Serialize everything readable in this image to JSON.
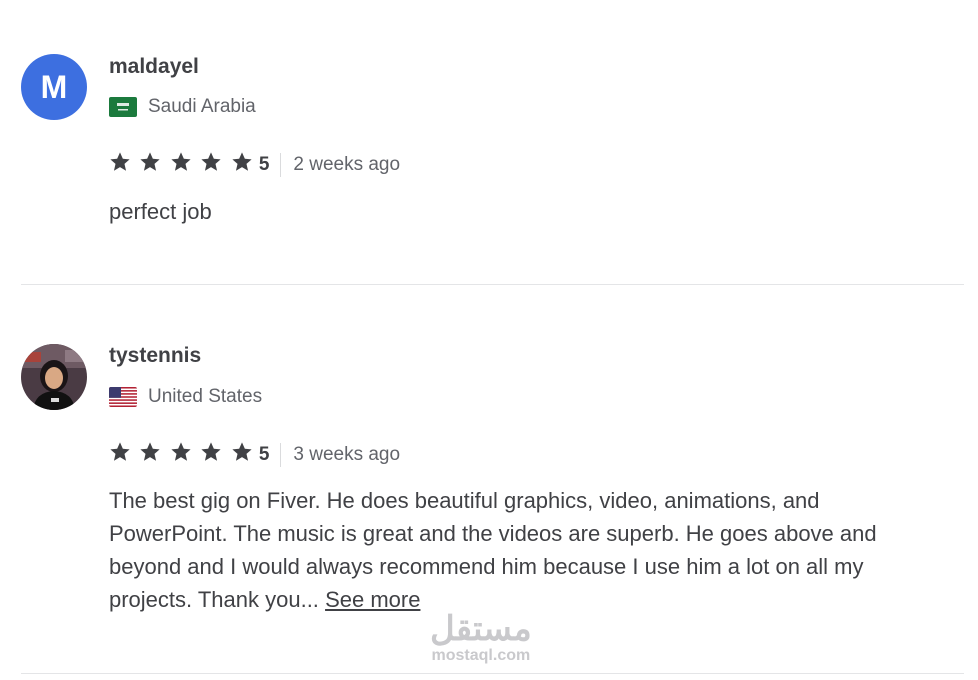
{
  "reviews": [
    {
      "avatar_letter": "M",
      "avatar_color": "#3d6fe0",
      "username": "maldayel",
      "country": "Saudi Arabia",
      "flag_icon": "saudi-arabia-flag-icon",
      "rating": "5",
      "stars": 5,
      "time_ago": "2 weeks ago",
      "text": "perfect job"
    },
    {
      "avatar_icon": "user-photo-avatar",
      "username": "tystennis",
      "country": "United States",
      "flag_icon": "united-states-flag-icon",
      "rating": "5",
      "stars": 5,
      "time_ago": "3 weeks ago",
      "text": "The best gig on Fiver. He does beautiful graphics, video, animations, and PowerPoint. The music is great and the videos are superb. He goes above and beyond and I would always recommend him because I use him a lot on all my projects. Thank you...",
      "see_more": "See more"
    }
  ],
  "watermark": {
    "arabic": "مستقل",
    "latin": "mostaql.com"
  },
  "colors": {
    "text": "#404145",
    "muted": "#62646a",
    "divider": "#e4e5e7",
    "star": "#404145"
  }
}
